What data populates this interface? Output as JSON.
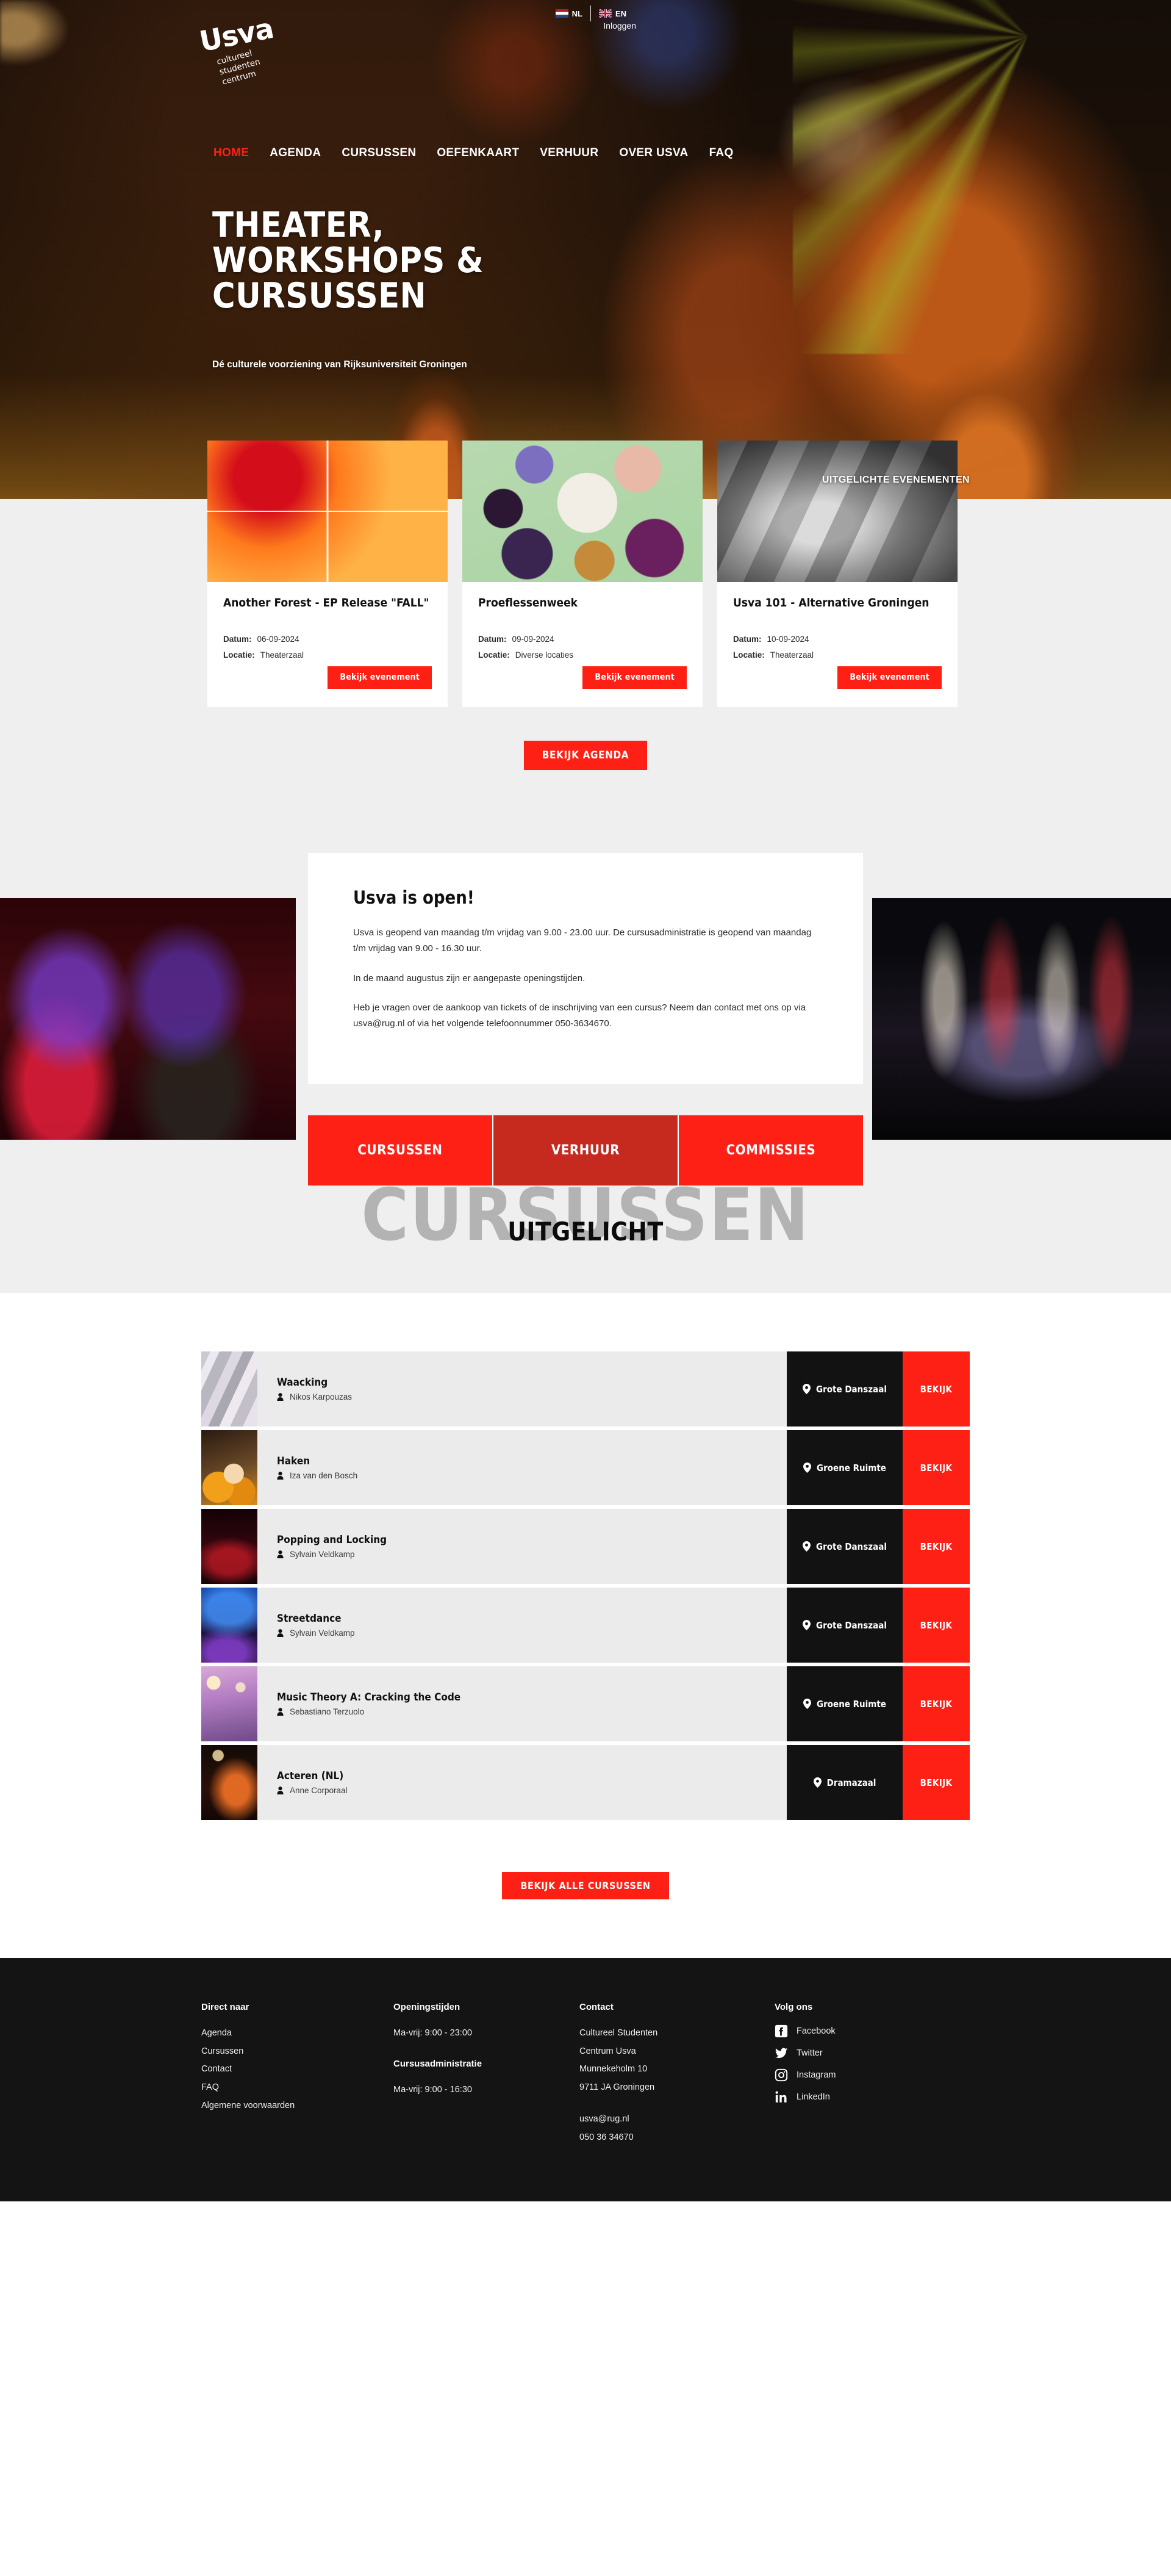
{
  "topbar": {
    "languages": [
      {
        "code": "NL",
        "flag": "nl-flag-icon"
      },
      {
        "code": "EN",
        "flag": "gb-flag-icon"
      }
    ],
    "login_label": "Inloggen"
  },
  "logo": {
    "wordmark": "Usva",
    "line1": "cultureel",
    "line2": "studenten",
    "line3": "centrum"
  },
  "nav": {
    "items": [
      {
        "label": "HOME",
        "active": true
      },
      {
        "label": "AGENDA",
        "active": false
      },
      {
        "label": "CURSUSSEN",
        "active": false
      },
      {
        "label": "OEFENKAART",
        "active": false
      },
      {
        "label": "VERHUUR",
        "active": false
      },
      {
        "label": "OVER USVA",
        "active": false
      },
      {
        "label": "FAQ",
        "active": false
      }
    ]
  },
  "hero": {
    "title_line1": "THEATER,",
    "title_line2": "WORKSHOPS &",
    "title_line3": "CURSUSSEN",
    "subtitle": "Dé culturele voorziening van Rijksuniversiteit Groningen",
    "featured_label": "UITGELICHTE EVENEMENTEN"
  },
  "events": {
    "date_label": "Datum:",
    "location_label": "Locatie:",
    "button_label": "Bekijk evenement",
    "agenda_button": "BEKIJK AGENDA",
    "items": [
      {
        "title": "Another Forest - EP Release \"FALL\"",
        "date": "06-09-2024",
        "location": "Theaterzaal",
        "thumb": "event-thumb-another-forest"
      },
      {
        "title": "Proeflessenweek",
        "date": "09-09-2024",
        "location": "Diverse locaties",
        "thumb": "event-thumb-proeflessenweek"
      },
      {
        "title": "Usva 101 - Alternative Groningen",
        "date": "10-09-2024",
        "location": "Theaterzaal",
        "thumb": "event-thumb-usva-101"
      }
    ]
  },
  "open_block": {
    "title": "Usva is open!",
    "paragraph1": "Usva is geopend van maandag t/m vrijdag van 9.00 - 23.00 uur. De cursusadministratie is geopend van maandag t/m vrijdag van 9.00 - 16.30 uur.",
    "paragraph2": "In de maand augustus zijn er aangepaste openingstijden.",
    "paragraph3": "Heb je vragen over de aankoop van tickets of de inschrijving van een cursus? Neem dan contact met ons op via usva@rug.nl of via het volgende telefoonnummer 050-3634670."
  },
  "cta_blocks": [
    {
      "label": "CURSUSSEN",
      "color": "#ff2015"
    },
    {
      "label": "VERHUUR",
      "color": "#c62a1f"
    },
    {
      "label": "COMMISSIES",
      "color": "#ff2015"
    }
  ],
  "courses_section": {
    "ghost_heading": "CURSUSSEN",
    "heading": "UITGELICHT",
    "view_button": "BEKIJK",
    "all_button": "BEKIJK ALLE CURSUSSEN",
    "items": [
      {
        "title": "Waacking",
        "teacher": "Nikos Karpouzas",
        "location": "Grote Danszaal"
      },
      {
        "title": "Haken",
        "teacher": "Iza van den Bosch",
        "location": "Groene Ruimte"
      },
      {
        "title": "Popping and Locking",
        "teacher": "Sylvain Veldkamp",
        "location": "Grote Danszaal"
      },
      {
        "title": "Streetdance",
        "teacher": "Sylvain Veldkamp",
        "location": "Grote Danszaal"
      },
      {
        "title": "Music Theory A: Cracking the Code",
        "teacher": "Sebastiano Terzuolo",
        "location": "Groene Ruimte"
      },
      {
        "title": "Acteren (NL)",
        "teacher": "Anne Corporaal",
        "location": "Dramazaal"
      }
    ]
  },
  "footer": {
    "col1": {
      "heading": "Direct naar",
      "links": [
        "Agenda",
        "Cursussen",
        "Contact",
        "FAQ",
        "Algemene voorwaarden"
      ]
    },
    "col2": {
      "heading1": "Openingstijden",
      "hours1": "Ma-vrij: 9:00 - 23:00",
      "heading2": "Cursusadministratie",
      "hours2": "Ma-vrij: 9:00 - 16:30"
    },
    "col3": {
      "heading": "Contact",
      "line1": "Cultureel Studenten",
      "line2": "Centrum Usva",
      "line3": "Munnekeholm 10",
      "line4": "9711 JA Groningen",
      "email": "usva@rug.nl",
      "phone": "050 36 34670"
    },
    "col4": {
      "heading": "Volg ons",
      "socials": [
        {
          "label": "Facebook",
          "icon": "facebook-icon"
        },
        {
          "label": "Twitter",
          "icon": "twitter-icon"
        },
        {
          "label": "Instagram",
          "icon": "instagram-icon"
        },
        {
          "label": "LinkedIn",
          "icon": "linkedin-icon"
        }
      ]
    }
  },
  "colors": {
    "accent_red": "#ff2015",
    "dark": "#141414",
    "light_grey": "#efefef",
    "row_grey": "#ebebeb"
  }
}
